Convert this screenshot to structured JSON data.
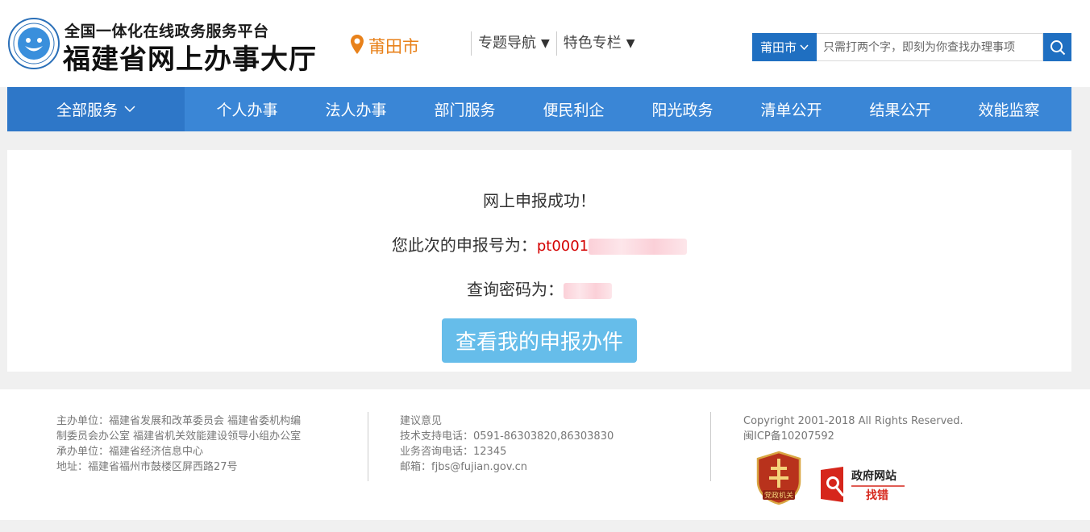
{
  "header": {
    "platform_title": "全国一体化在线政务服务平台",
    "site_title": "福建省网上办事大厅",
    "city": "莆田市",
    "links": [
      {
        "label": "专题导航"
      },
      {
        "label": "特色专栏"
      }
    ],
    "search": {
      "city_label": "莆田市",
      "placeholder": "只需打两个字，即刻为你查找办理事项"
    }
  },
  "main_nav": {
    "all_label": "全部服务",
    "items": [
      "个人办事",
      "法人办事",
      "部门服务",
      "便民利企",
      "阳光政务",
      "清单公开",
      "结果公开",
      "效能监察"
    ]
  },
  "content": {
    "success_message": "网上申报成功！",
    "report_label": "您此次的申报号为：",
    "report_number_visible": "pt0001",
    "password_label": "查询密码为：",
    "view_button": "查看我的申报办件"
  },
  "footer": {
    "col1": [
      "主办单位：福建省发展和改革委员会 福建省委机构编",
      "制委员会办公室 福建省机关效能建设领导小组办公室",
      "承办单位：福建省经济信息中心",
      "地址：福建省福州市鼓楼区屏西路27号"
    ],
    "col2": [
      "建议意见",
      "技术支持电话：0591-86303820,86303830",
      "业务咨询电话：12345",
      "邮箱：fjbs@fujian.gov.cn"
    ],
    "col3": [
      "Copyright 2001-2018 All Rights Reserved.",
      "闽ICP备10207592"
    ],
    "badge_party": "党政机关",
    "badge_gov_line1": "政府网站",
    "badge_gov_line2": "找错"
  },
  "colors": {
    "primary_blue": "#3a86d6",
    "dark_blue": "#1f6fc1",
    "orange": "#e8811a",
    "red": "#d40000",
    "button_blue": "#66bdea"
  }
}
